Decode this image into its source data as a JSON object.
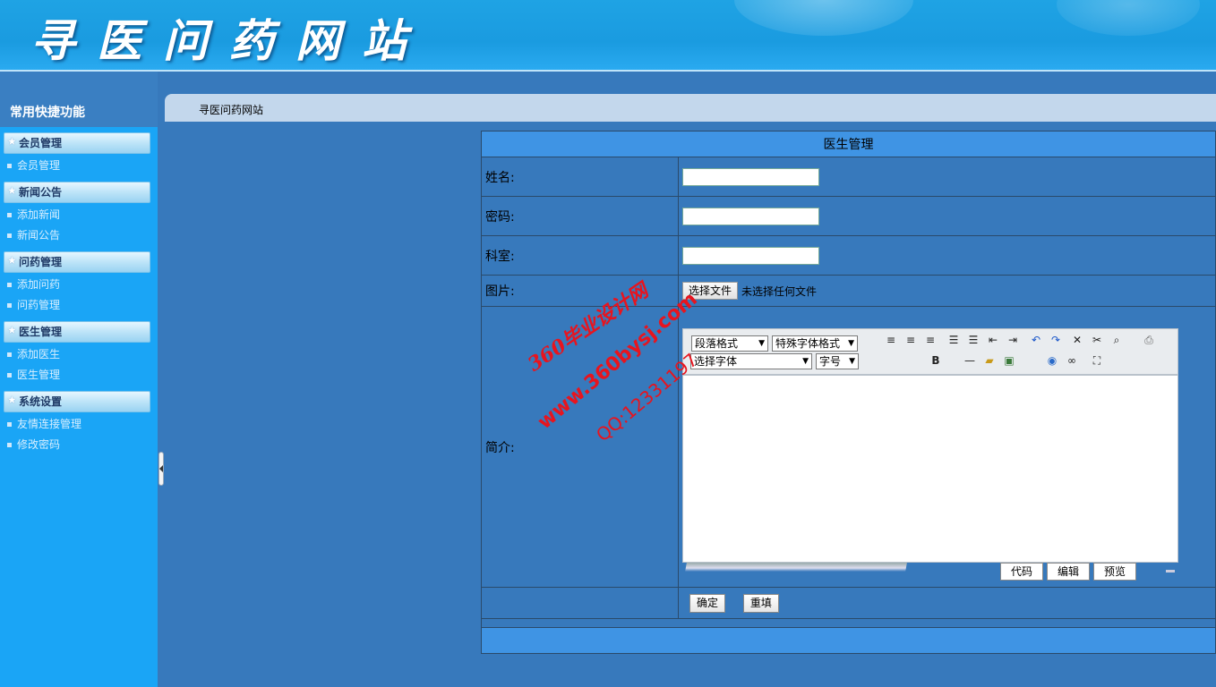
{
  "header": {
    "site_title": "寻医问药网站"
  },
  "sidebar": {
    "title": "常用快捷功能",
    "groups": [
      {
        "title": "会员管理",
        "items": [
          "会员管理"
        ]
      },
      {
        "title": "新闻公告",
        "items": [
          "添加新闻",
          "新闻公告"
        ]
      },
      {
        "title": "问药管理",
        "items": [
          "添加问药",
          "问药管理"
        ]
      },
      {
        "title": "医生管理",
        "items": [
          "添加医生",
          "医生管理"
        ]
      },
      {
        "title": "系统设置",
        "items": [
          "友情连接管理",
          "修改密码"
        ]
      }
    ]
  },
  "breadcrumb": {
    "text": "寻医问药网站"
  },
  "form": {
    "title": "医生管理",
    "fields": {
      "name_label": "姓名:",
      "name_value": "",
      "password_label": "密码:",
      "password_value": "",
      "department_label": "科室:",
      "department_value": "",
      "image_label": "图片:",
      "file_button": "选择文件",
      "file_status": "未选择任何文件",
      "intro_label": "简介:"
    },
    "editor": {
      "paragraph_select": "段落格式",
      "special_font_select": "特殊字体格式",
      "font_select": "选择字体",
      "size_select": "字号",
      "mode_code": "代码",
      "mode_edit": "编辑",
      "mode_preview": "预览",
      "content": ""
    },
    "buttons": {
      "submit": "确定",
      "reset": "重填"
    }
  },
  "watermark": {
    "line1": "360毕业设计网",
    "line2": "www.360bysj.com",
    "line3": "QQ:12331197",
    "color": "#e8141e"
  }
}
